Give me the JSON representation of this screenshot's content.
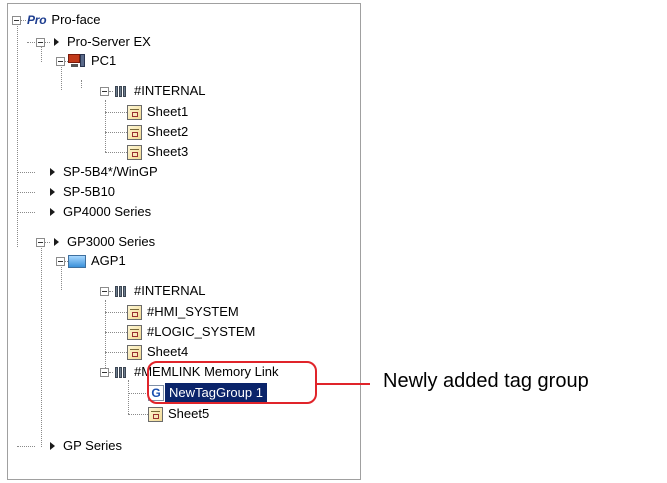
{
  "tree": {
    "root_logo": "Pro",
    "root_label": "Pro-face",
    "pro_server": "Pro-Server EX",
    "pc1": "PC1",
    "pc1_internal": "#INTERNAL",
    "pc1_sheet1": "Sheet1",
    "pc1_sheet2": "Sheet2",
    "pc1_sheet3": "Sheet3",
    "sp5b4": "SP-5B4*/WinGP",
    "sp5b10": "SP-5B10",
    "gp4000": "GP4000 Series",
    "gp3000": "GP3000 Series",
    "agp1": "AGP1",
    "agp1_internal": "#INTERNAL",
    "hmi_system": "#HMI_SYSTEM",
    "logic_system": "#LOGIC_SYSTEM",
    "sheet4": "Sheet4",
    "memlink": "#MEMLINK Memory Link",
    "new_tag_group": "NewTagGroup 1",
    "sheet5": "Sheet5",
    "gp_series": "GP Series"
  },
  "annotation": {
    "label": "Newly added tag group",
    "color": "#e0242a"
  },
  "selection_color": "#0a246a"
}
